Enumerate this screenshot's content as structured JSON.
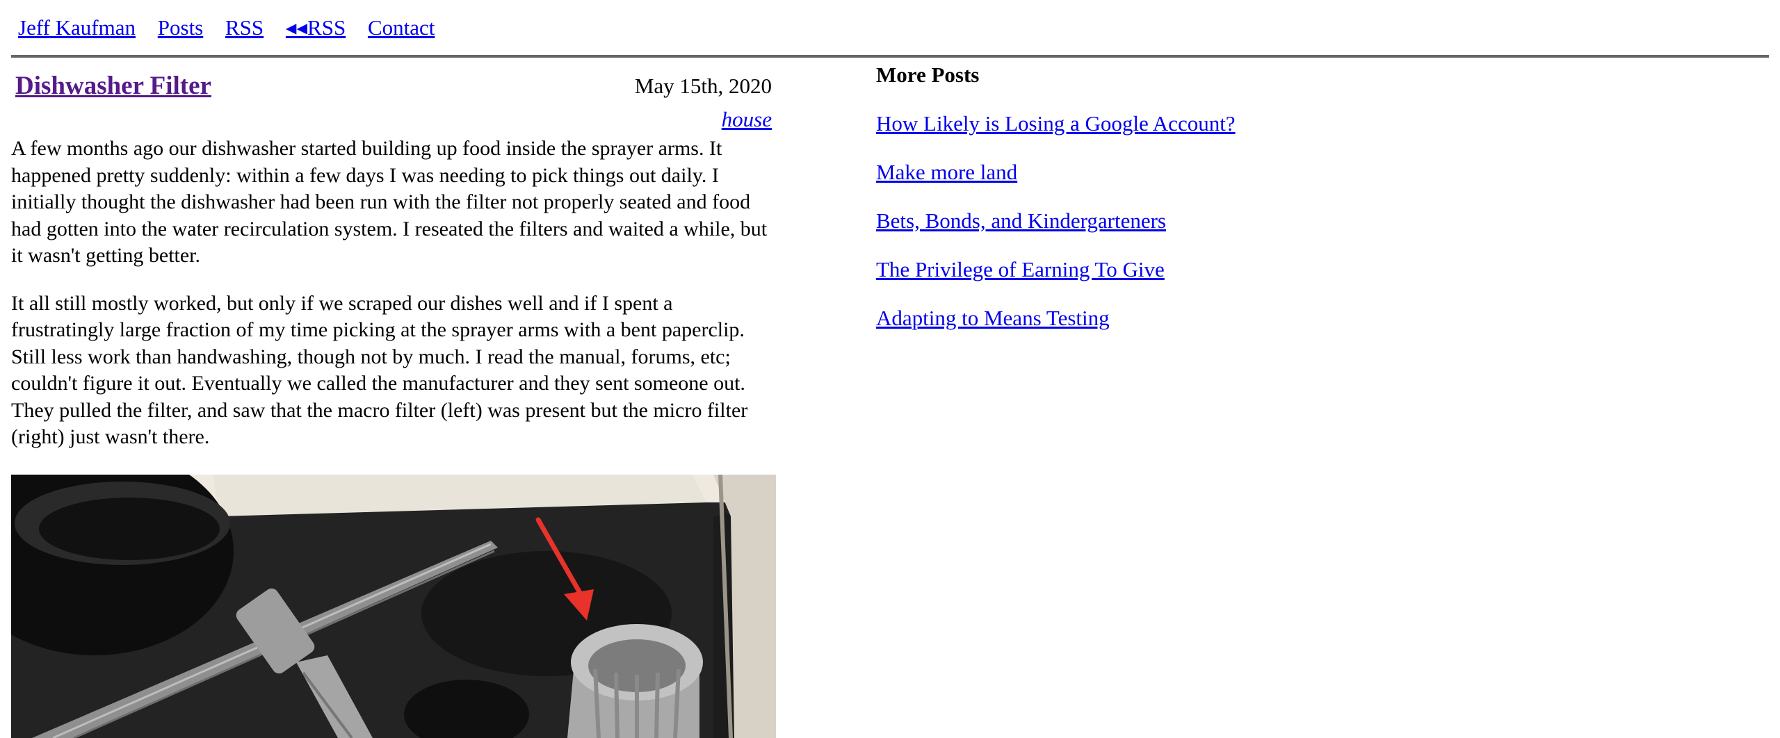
{
  "nav": {
    "items": [
      {
        "label": "Jeff Kaufman"
      },
      {
        "label": "Posts"
      },
      {
        "label": "RSS"
      },
      {
        "label": "◂◂RSS"
      },
      {
        "label": "Contact"
      }
    ]
  },
  "post": {
    "title": "Dishwasher Filter",
    "date": "May 15th, 2020",
    "tag": "house",
    "paragraphs": [
      "A few months ago our dishwasher started building up food inside the sprayer arms. It happened pretty suddenly: within a few days I was needing to pick things out daily. I initially thought the dishwasher had been run with the filter not properly seated and food had gotten into the water recirculation system. I reseated the filters and waited a while, but it wasn't getting better.",
      "It all still mostly worked, but only if we scraped our dishes well and if I spent a frustratingly large fraction of my time picking at the sprayer arms with a bent paperclip. Still less work than handwashing, though not by much. I read the manual, forums, etc; couldn't figure it out. Eventually we called the manufacturer and they sent someone out. They pulled the filter, and saw that the macro filter (left) was present but the micro filter (right) just wasn't there."
    ],
    "photo_arrow_color": "#e8322a"
  },
  "more_posts": {
    "heading": "More Posts",
    "links": [
      {
        "label": "How Likely is Losing a Google Account?"
      },
      {
        "label": "Make more land"
      },
      {
        "label": "Bets, Bonds, and Kindergarteners"
      },
      {
        "label": "The Privilege of Earning To Give"
      },
      {
        "label": "Adapting to Means Testing"
      }
    ]
  }
}
